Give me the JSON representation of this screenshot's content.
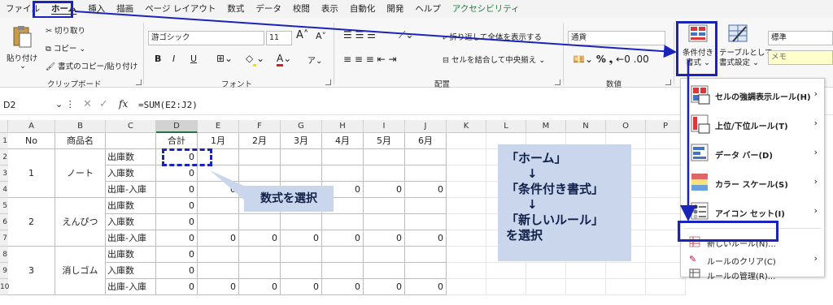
{
  "tabs": [
    "ファイル",
    "ホーム",
    "挿入",
    "描画",
    "ページ レイアウト",
    "数式",
    "データ",
    "校閲",
    "表示",
    "自動化",
    "開発",
    "ヘルプ",
    "アクセシビリティ"
  ],
  "ribbon": {
    "clipboard": {
      "paste": "貼り付け",
      "cut": "切り取り",
      "copy": "コピー",
      "format_painter": "書式のコピー/貼り付け",
      "label": "クリップボード"
    },
    "font": {
      "name": "游ゴシック",
      "size": "11",
      "bold": "B",
      "italic": "I",
      "underline": "U",
      "label": "フォント"
    },
    "alignment": {
      "wrap": "折り返して全体を表示する",
      "merge": "セルを結合して中央揃え",
      "label": "配置"
    },
    "number": {
      "format": "通貨",
      "label": "数値"
    },
    "styles": {
      "conditional_line1": "条件付き",
      "conditional_line2": "書式",
      "table_line1": "テーブルとして",
      "table_line2": "書式設定",
      "style_normal": "標準",
      "style_memo": "メモ"
    }
  },
  "formula_bar": {
    "cell": "D2",
    "fx": "fx",
    "formula": "=SUM(E2:J2)"
  },
  "columns": [
    "A",
    "B",
    "C",
    "D",
    "E",
    "F",
    "G",
    "H",
    "I",
    "J",
    "K",
    "L",
    "M",
    "N",
    "O",
    "P"
  ],
  "row_numbers": [
    "1",
    "2",
    "3",
    "4",
    "5",
    "6",
    "7",
    "8",
    "9",
    "10"
  ],
  "header_row": [
    "No",
    "商品名",
    "",
    "合計",
    "1月",
    "2月",
    "3月",
    "4月",
    "5月",
    "6月"
  ],
  "groups": [
    {
      "no": "1",
      "name": "ノート"
    },
    {
      "no": "2",
      "name": "えんぴつ"
    },
    {
      "no": "3",
      "name": "消しゴム"
    }
  ],
  "row_labels": [
    "出庫数",
    "入庫数",
    "出庫-入庫"
  ],
  "values": {
    "total": "0",
    "diff_months": "0"
  },
  "callout_formula": "数式を選択",
  "callout_steps": [
    "「ホーム」",
    "↓",
    "「条件付き書式」",
    "↓",
    "「新しいルール」",
    "を選択"
  ],
  "menu": {
    "items": [
      {
        "label": "セルの強調表示ルール(H)"
      },
      {
        "label": "上位/下位ルール(T)"
      },
      {
        "label": "データ バー(D)"
      },
      {
        "label": "カラー スケール(S)"
      },
      {
        "label": "アイコン セット(I)"
      }
    ],
    "actions": [
      {
        "label": "新しいルール(N)..."
      },
      {
        "label": "ルールのクリア(C)"
      },
      {
        "label": "ルールの管理(R)..."
      }
    ]
  },
  "accent_color": "#1a24b8"
}
